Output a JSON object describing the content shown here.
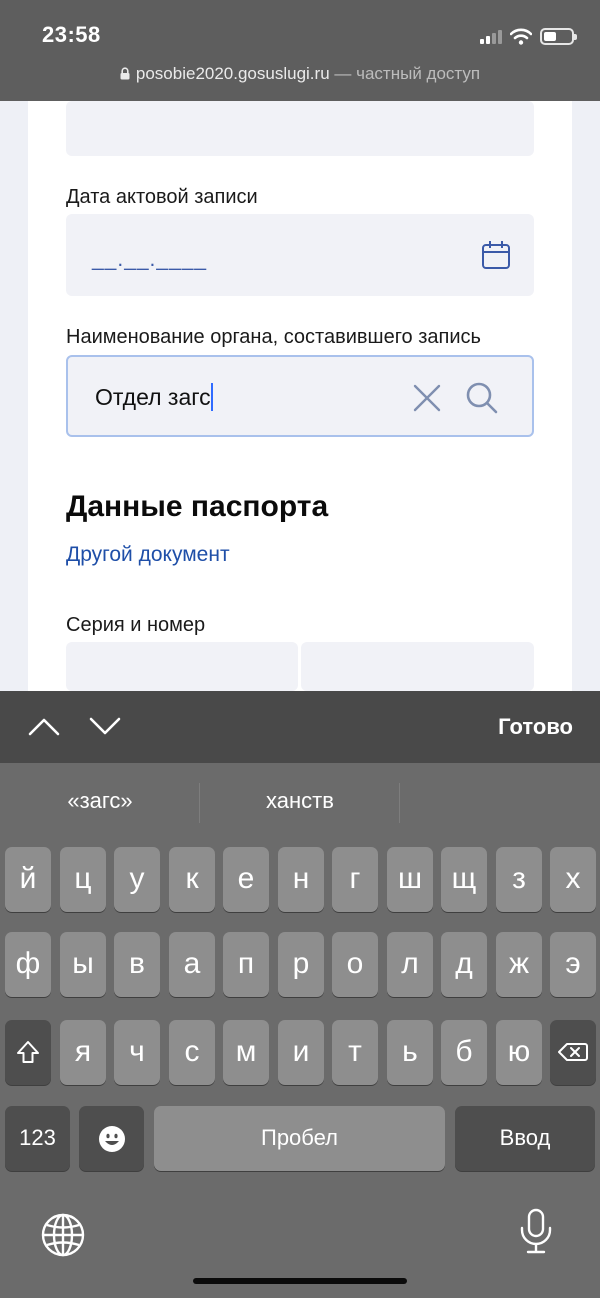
{
  "status_bar": {
    "time": "23:58"
  },
  "browser": {
    "domain": "posobie2020.gosuslugi.ru",
    "access_note": "— частный доступ"
  },
  "form": {
    "date_label": "Дата актовой записи",
    "date_placeholder": "__.__.____",
    "organ_label": "Наименование органа, составившего запись",
    "organ_value": "Отдел загс",
    "passport_title": "Данные паспорта",
    "other_doc_link": "Другой документ",
    "series_label": "Серия и номер"
  },
  "keyboard_toolbar": {
    "done_label": "Готово"
  },
  "suggestions": [
    "«загс»",
    "ханств",
    ""
  ],
  "keyboard": {
    "row1": [
      "й",
      "ц",
      "у",
      "к",
      "е",
      "н",
      "г",
      "ш",
      "щ",
      "з",
      "х"
    ],
    "row2": [
      "ф",
      "ы",
      "в",
      "а",
      "п",
      "р",
      "о",
      "л",
      "д",
      "ж",
      "э"
    ],
    "row3": [
      "я",
      "ч",
      "с",
      "м",
      "и",
      "т",
      "ь",
      "б",
      "ю"
    ],
    "numbers_label": "123",
    "space_label": "Пробел",
    "return_label": "Ввод"
  },
  "colors": {
    "accent": "#1f4fa8",
    "focus_border": "#a9c1ec",
    "field_bg": "#f1f2f7"
  },
  "icons": [
    "lock-icon",
    "wifi-icon",
    "battery-icon",
    "calendar-icon",
    "clear-icon",
    "search-icon",
    "chevron-up-icon",
    "chevron-down-icon",
    "shift-icon",
    "backspace-icon",
    "emoji-icon",
    "globe-icon",
    "microphone-icon"
  ]
}
